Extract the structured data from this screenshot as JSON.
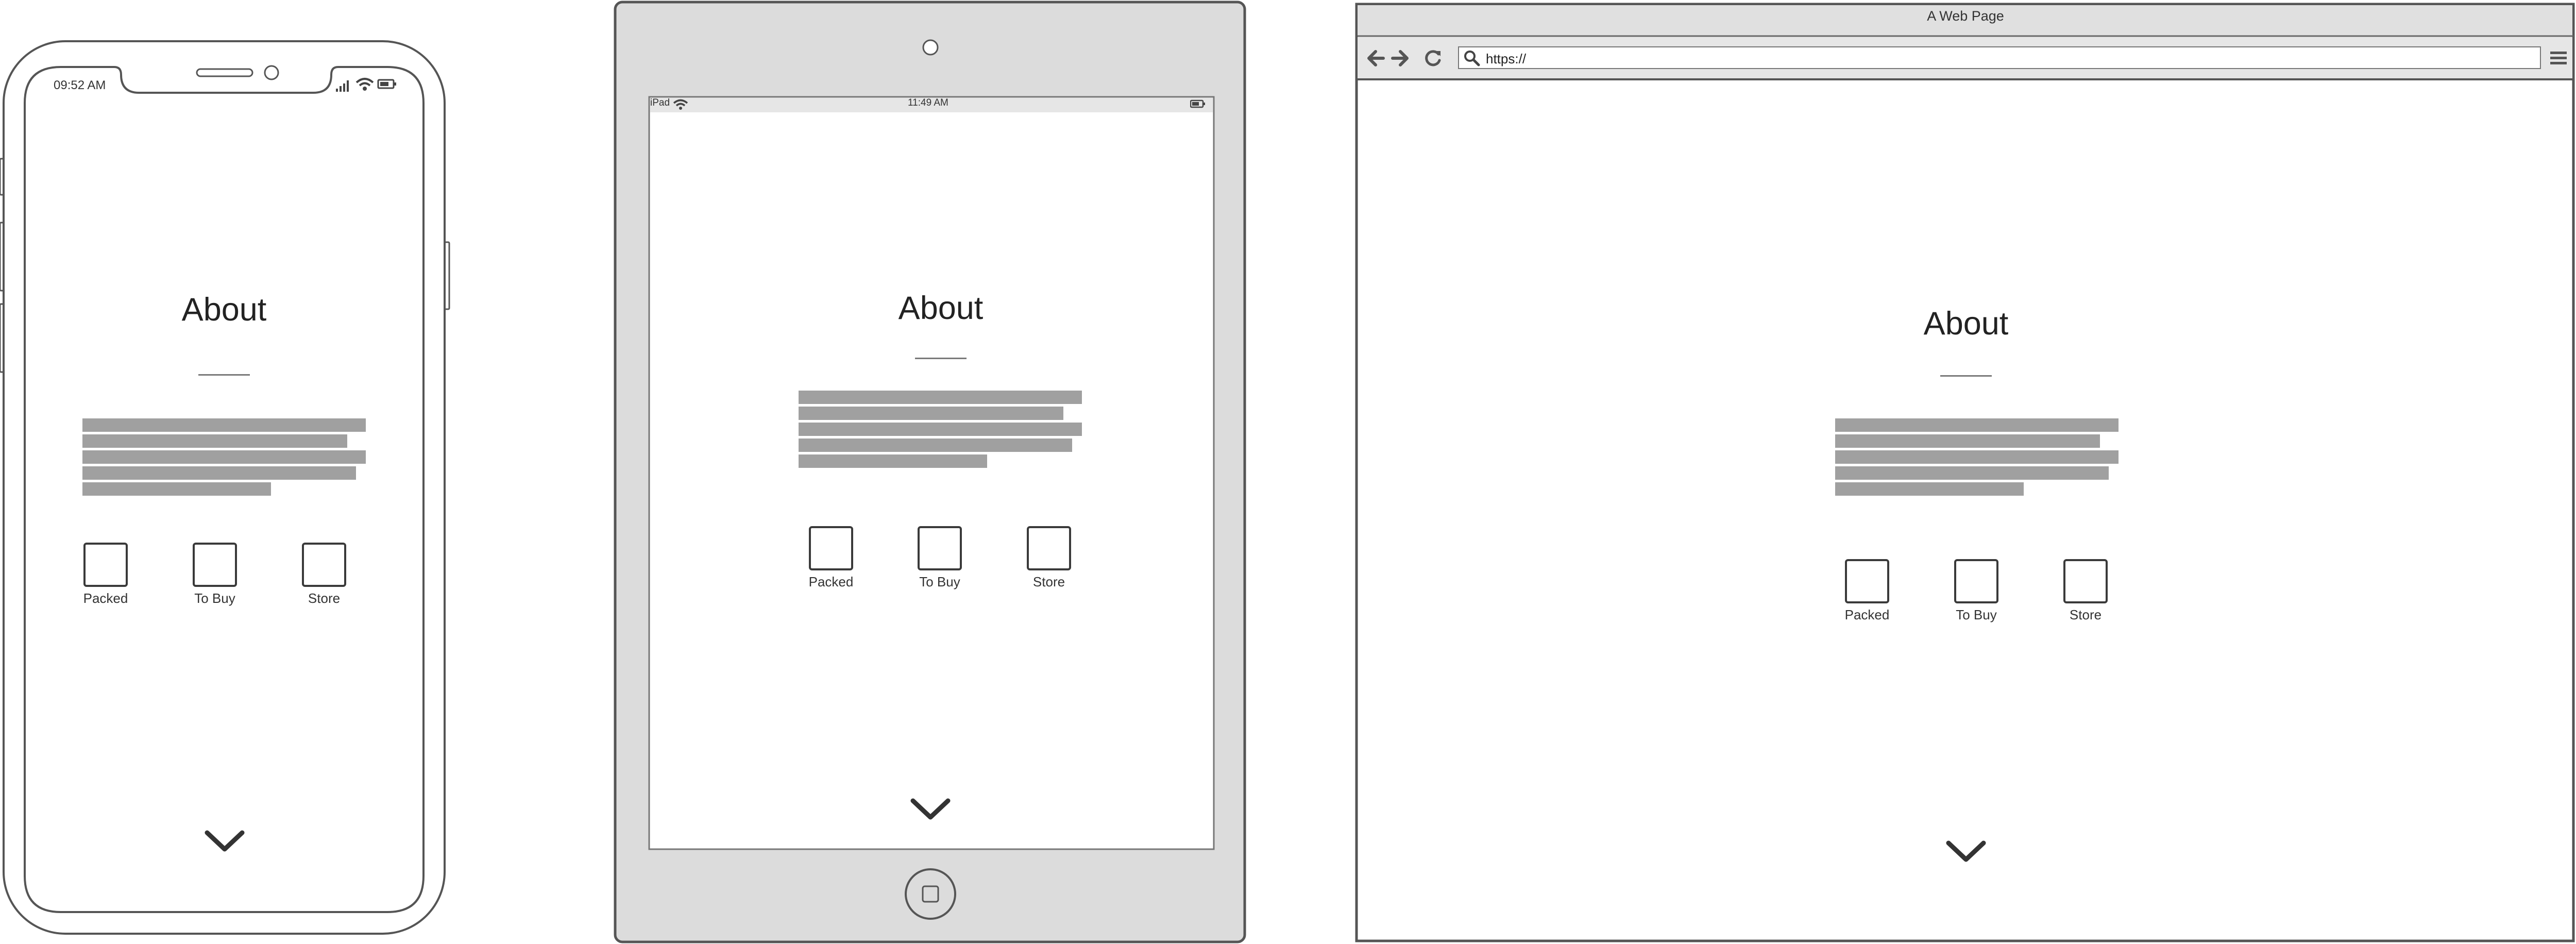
{
  "about": {
    "title": "About",
    "buttons": [
      "Packed",
      "To Buy",
      "Store"
    ]
  },
  "phone": {
    "time": "09:52 AM"
  },
  "tablet": {
    "carrier": "iPad",
    "time": "11:49 AM"
  },
  "browser": {
    "window_title": "A Web Page",
    "url": "https://"
  },
  "icons": {
    "signal": "signal-icon",
    "wifi": "wifi-icon",
    "battery": "battery-icon",
    "back": "arrow-left-icon",
    "forward": "arrow-right-icon",
    "reload": "reload-icon",
    "search": "search-icon",
    "menu": "hamburger-menu-icon",
    "scroll": "chevron-down-icon"
  }
}
